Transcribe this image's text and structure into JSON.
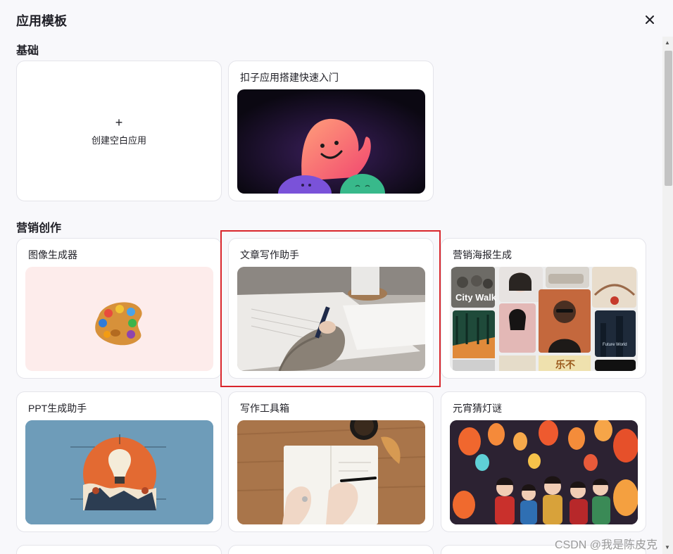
{
  "dialog": {
    "title": "应用模板"
  },
  "sections": {
    "basic": {
      "title": "基础"
    },
    "marketing": {
      "title": "营销创作"
    }
  },
  "cards": {
    "blank": {
      "plus": "+",
      "label": "创建空白应用"
    },
    "quickstart": {
      "title": "扣子应用搭建快速入门"
    },
    "image_gen": {
      "title": "图像生成器"
    },
    "article_writer": {
      "title": "文章写作助手"
    },
    "poster": {
      "title": "营销海报生成",
      "poster_text_1": "City Walk",
      "poster_text_2": "Future World",
      "poster_text_3": "乐不"
    },
    "ppt": {
      "title": "PPT生成助手"
    },
    "writing_tools": {
      "title": "写作工具箱"
    },
    "lantern_riddle": {
      "title": "元宵猜灯谜"
    }
  },
  "watermark": "CSDN @我是陈皮克",
  "icons": {
    "close": "close-icon",
    "scroll_up": "chevron-up-icon",
    "scroll_down": "chevron-down-icon"
  },
  "colors": {
    "highlight": "#d9262c",
    "card_border": "#e4e4ea"
  }
}
